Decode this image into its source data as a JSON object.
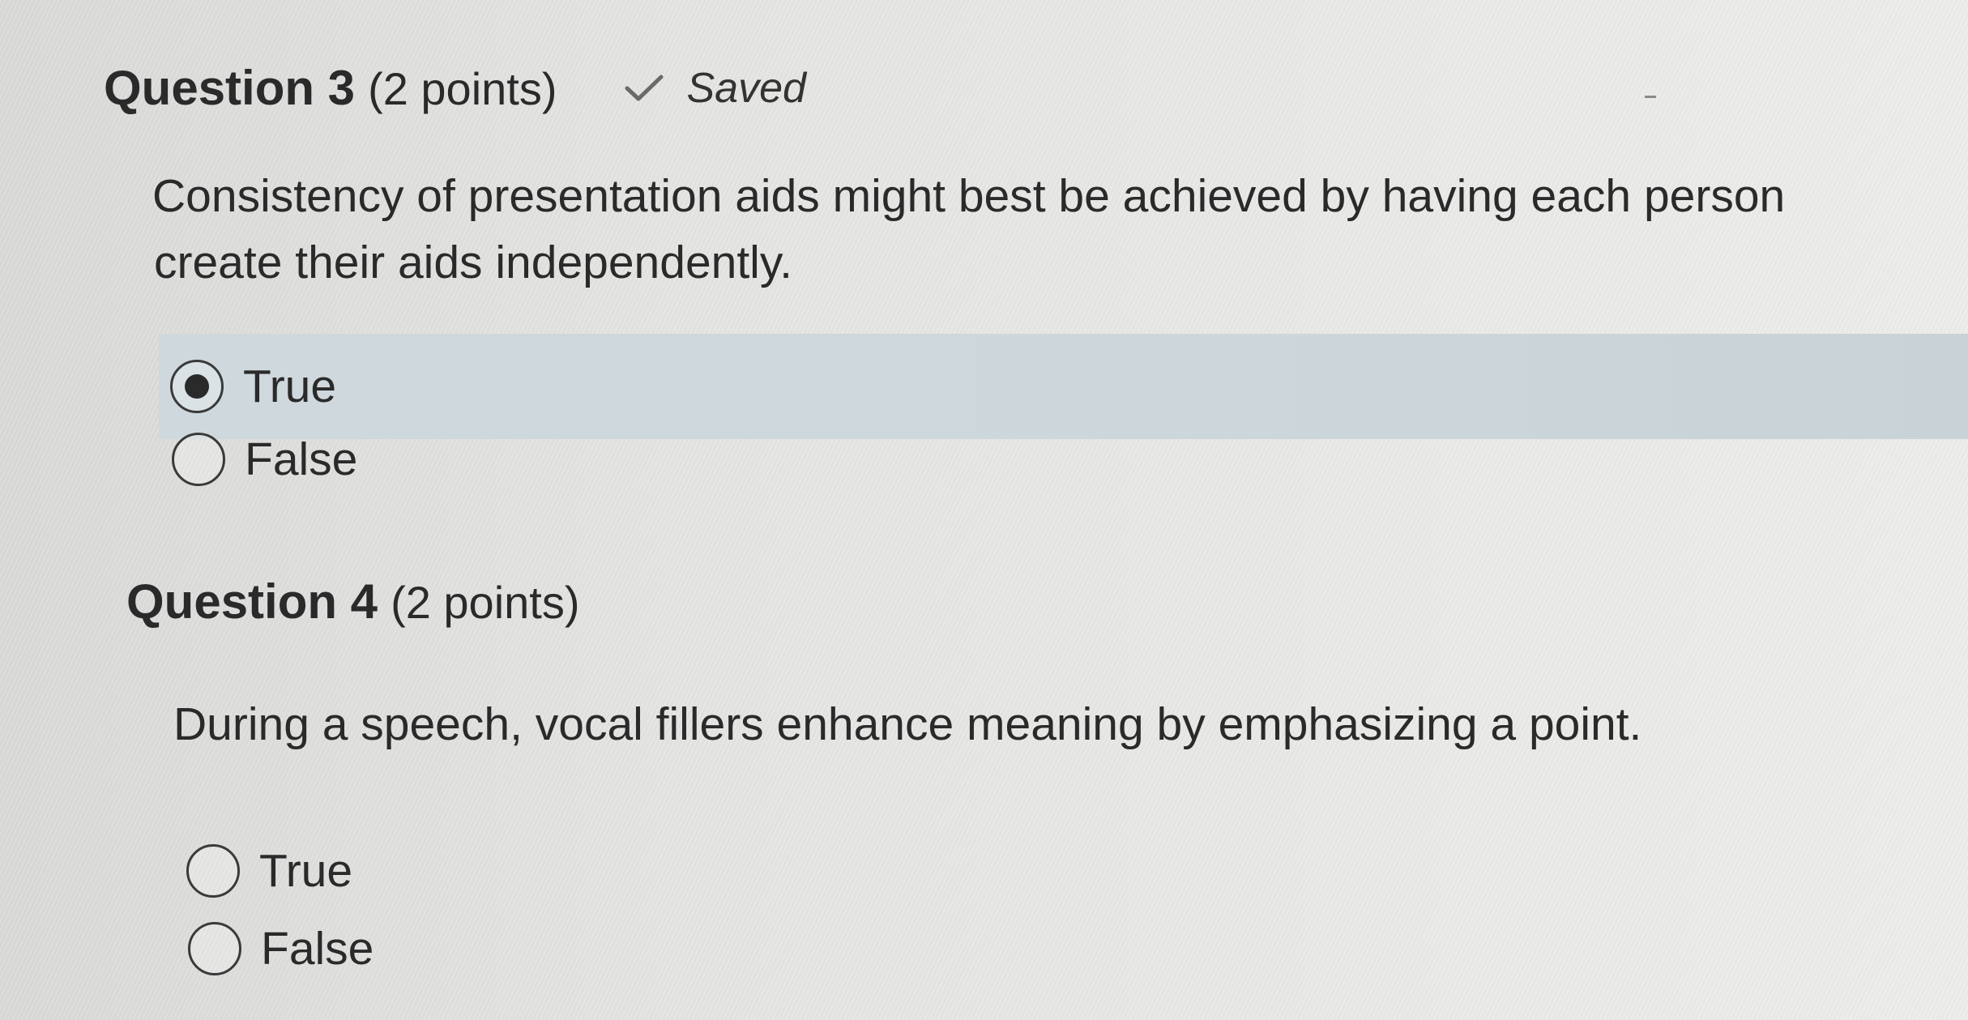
{
  "questions": [
    {
      "number": "Question 3",
      "points": "(2 points)",
      "status": "Saved",
      "text_line1": "Consistency of presentation aids might best be achieved by having each person",
      "text_line2": "create their aids independently.",
      "options": [
        {
          "label": "True",
          "selected": true
        },
        {
          "label": "False",
          "selected": false
        }
      ]
    },
    {
      "number": "Question 4",
      "points": "(2 points)",
      "text_line1": "During a speech, vocal fillers enhance meaning by emphasizing a point.",
      "options": [
        {
          "label": "True",
          "selected": false
        },
        {
          "label": "False",
          "selected": false
        }
      ]
    }
  ],
  "icons": {
    "saved": "check-icon",
    "radio_selected": "radio-selected-icon",
    "radio_empty": "radio-empty-icon"
  },
  "colors": {
    "selected_row": "#cfd8dc",
    "text": "#2a2a2a"
  }
}
